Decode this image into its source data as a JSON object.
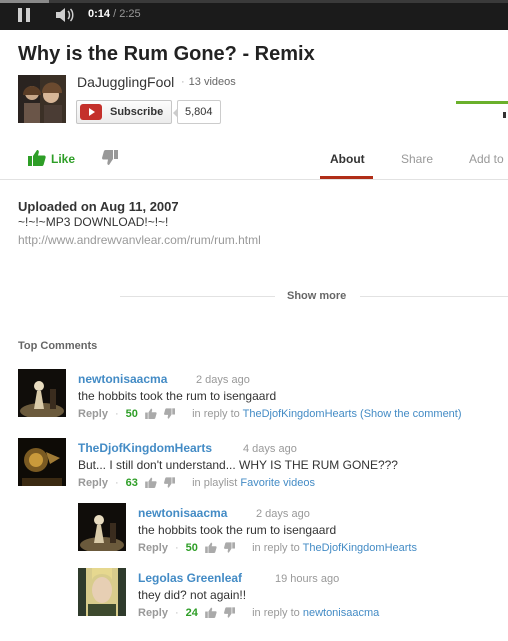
{
  "player": {
    "current_time": "0:14",
    "separator": " / ",
    "duration": "2:25",
    "progress": 0.0966
  },
  "video": {
    "title": "Why is the Rum Gone? - Remix",
    "channel_name": "DaJugglingFool",
    "video_count": "13 videos",
    "subscribe_label": "Subscribe",
    "subscriber_count": "5,804"
  },
  "actions": {
    "like_label": "Like",
    "tabs": [
      "About",
      "Share",
      "Add to"
    ],
    "active_tab": "About"
  },
  "description": {
    "uploaded": "Uploaded on Aug 11, 2007",
    "line1": "~!~!~MP3 DOWNLOAD!~!~!",
    "link": "http://www.andrewvanvlear.com/rum/rum.html",
    "show_more": "Show more"
  },
  "comments": {
    "heading": "Top Comments",
    "reply_label": "Reply",
    "items": [
      {
        "author": "newtonisaacma",
        "time": "2 days ago",
        "text": "the hobbits took the rum to isengaard",
        "score": "50",
        "context_prefix": "in reply to ",
        "context_link": "TheDjofKingdomHearts",
        "context_extra": " (Show the comment)"
      },
      {
        "author": "TheDjofKingdomHearts",
        "time": "4 days ago",
        "text": "But... I still don't understand... WHY IS THE RUM GONE???",
        "score": "63",
        "context_prefix": "in playlist ",
        "context_link": "Favorite videos",
        "context_extra": ""
      },
      {
        "author": "newtonisaacma",
        "time": "2 days ago",
        "text": "the hobbits took the rum to isengaard",
        "score": "50",
        "context_prefix": "in reply to ",
        "context_link": "TheDjofKingdomHearts",
        "context_extra": ""
      },
      {
        "author": "Legolas Greenleaf",
        "time": "19 hours ago",
        "text": "they did? not again!!",
        "score": "24",
        "context_prefix": "in reply to ",
        "context_link": "newtonisaacma",
        "context_extra": ""
      }
    ]
  },
  "colors": {
    "link_blue": "#438bc5",
    "like_green": "#2e9e27",
    "tab_active_underline": "#b02d17",
    "youtube_red": "#c4302b"
  },
  "icons": [
    "pause-icon",
    "volume-icon",
    "youtube-logo-icon",
    "thumbs-up-icon",
    "thumbs-down-icon"
  ]
}
